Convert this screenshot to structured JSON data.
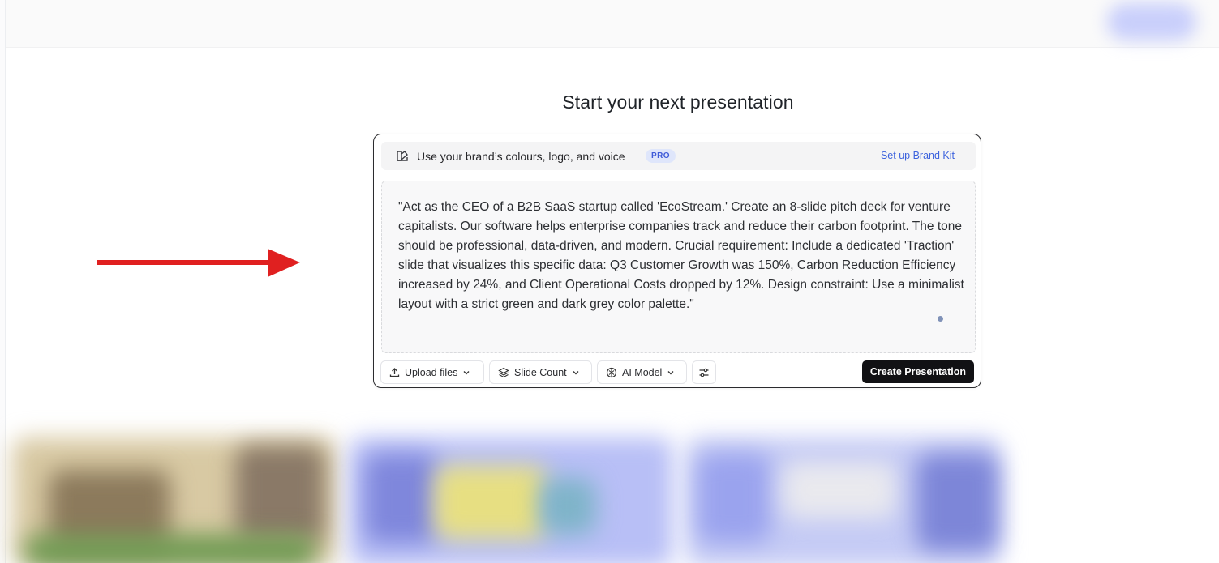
{
  "header": {
    "title": "Start your next presentation"
  },
  "brand_kit": {
    "text": "Use your brand’s colours, logo, and voice",
    "badge": "PRO",
    "link": "Set up Brand Kit",
    "icon": "brand-kit-icon"
  },
  "prompt": {
    "value": "\"Act as the CEO of a B2B SaaS startup called 'EcoStream.' Create an 8-slide pitch deck for venture capitalists. Our software helps enterprise companies track and reduce their carbon footprint. The tone should be professional, data-driven, and modern. Crucial requirement: Include a dedicated 'Traction' slide that visualizes this specific data: Q3 Customer Growth was 150%, Carbon Reduction Efficiency increased by 24%, and Client Operational Costs dropped by 12%. Design constraint: Use a minimalist layout with a strict green and dark grey color palette.\""
  },
  "toolbar": {
    "upload_label": "Upload files",
    "slide_count_label": "Slide Count",
    "ai_model_label": "AI Model",
    "create_label": "Create Presentation"
  },
  "colors": {
    "accent_link": "#3d63dd",
    "annotation_arrow": "#e02020",
    "primary_button": "#111114"
  }
}
